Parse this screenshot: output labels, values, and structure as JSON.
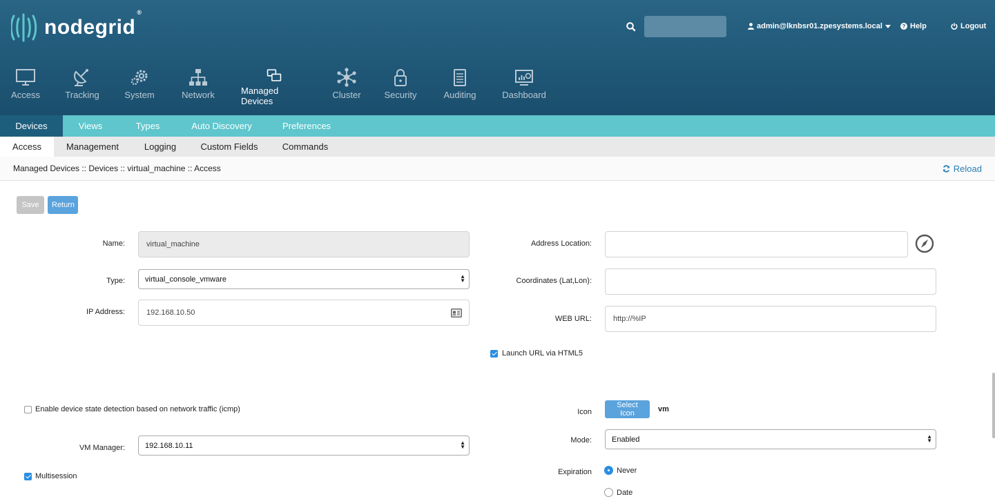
{
  "header": {
    "logo_text": "nodegrid",
    "logo_reg": "®",
    "search": {
      "value": ""
    },
    "user": "admin@lknbsr01.zpesystems.local",
    "help": "Help",
    "logout": "Logout"
  },
  "nav": [
    {
      "label": "Access",
      "icon": "monitor-icon"
    },
    {
      "label": "Tracking",
      "icon": "satellite-icon"
    },
    {
      "label": "System",
      "icon": "gears-icon"
    },
    {
      "label": "Network",
      "icon": "network-icon"
    },
    {
      "label": "Managed Devices",
      "icon": "devices-icon",
      "active": true
    },
    {
      "label": "Cluster",
      "icon": "cluster-icon"
    },
    {
      "label": "Security",
      "icon": "lock-icon"
    },
    {
      "label": "Auditing",
      "icon": "notepad-icon"
    },
    {
      "label": "Dashboard",
      "icon": "dashboard-icon"
    }
  ],
  "tabs1": [
    "Devices",
    "Views",
    "Types",
    "Auto Discovery",
    "Preferences"
  ],
  "tabs2": [
    "Access",
    "Management",
    "Logging",
    "Custom Fields",
    "Commands"
  ],
  "breadcrumb": "Managed Devices :: Devices :: virtual_machine :: Access",
  "reload": "Reload",
  "buttons": {
    "save": "Save",
    "return": "Return",
    "select_icon": "Select Icon"
  },
  "form": {
    "name_label": "Name:",
    "name_value": "virtual_machine",
    "type_label": "Type:",
    "type_value": "virtual_console_vmware",
    "ip_label": "IP Address:",
    "ip_value": "192.168.10.50",
    "address_label": "Address Location:",
    "address_value": "",
    "coords_label": "Coordinates (Lat,Lon):",
    "coords_value": "",
    "weburl_label": "WEB URL:",
    "weburl_value": "http://%IP",
    "launch_html5_label": "Launch URL via HTML5",
    "launch_html5_checked": true,
    "icmp_label": "Enable device state detection based on network traffic (icmp)",
    "icmp_checked": false,
    "icon_label": "Icon",
    "icon_value": "vm",
    "vm_manager_label": "VM Manager:",
    "vm_manager_value": "192.168.10.11",
    "mode_label": "Mode:",
    "mode_value": "Enabled",
    "multisession_label": "Multisession",
    "multisession_checked": true,
    "expiration_label": "Expiration",
    "expiration_never": "Never",
    "expiration_date": "Date",
    "expiration_selected": "Never"
  },
  "colors": {
    "header": "#215a7a",
    "tabs1": "#5ec6cc",
    "active_tab": "#1e5e7d",
    "button": "#5aa3dd",
    "link": "#2a7fb6"
  }
}
